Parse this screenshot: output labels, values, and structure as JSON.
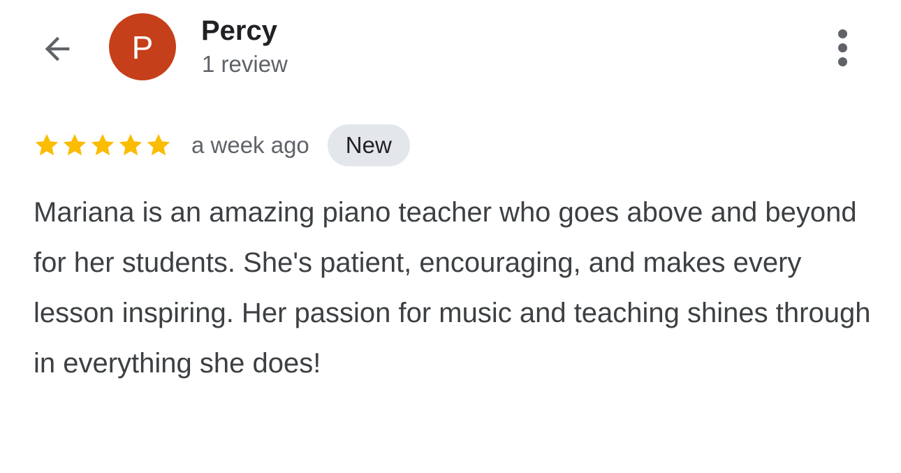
{
  "reviewer": {
    "avatar_letter": "P",
    "avatar_color": "#c5401a",
    "name": "Percy",
    "review_count": "1 review"
  },
  "review": {
    "rating": 5,
    "max_rating": 5,
    "star_color": "#fbbc04",
    "time_ago": "a week ago",
    "badge_label": "New",
    "badge_color": "#e3e6ea",
    "text": "Mariana is an amazing piano teacher who goes above and beyond for her students. She's patient, encouraging, and makes every lesson inspiring. Her passion for music and teaching shines through in everything she does!"
  },
  "icons": {
    "back": "arrow-left-icon",
    "more": "more-vert-icon",
    "star": "star-icon"
  }
}
